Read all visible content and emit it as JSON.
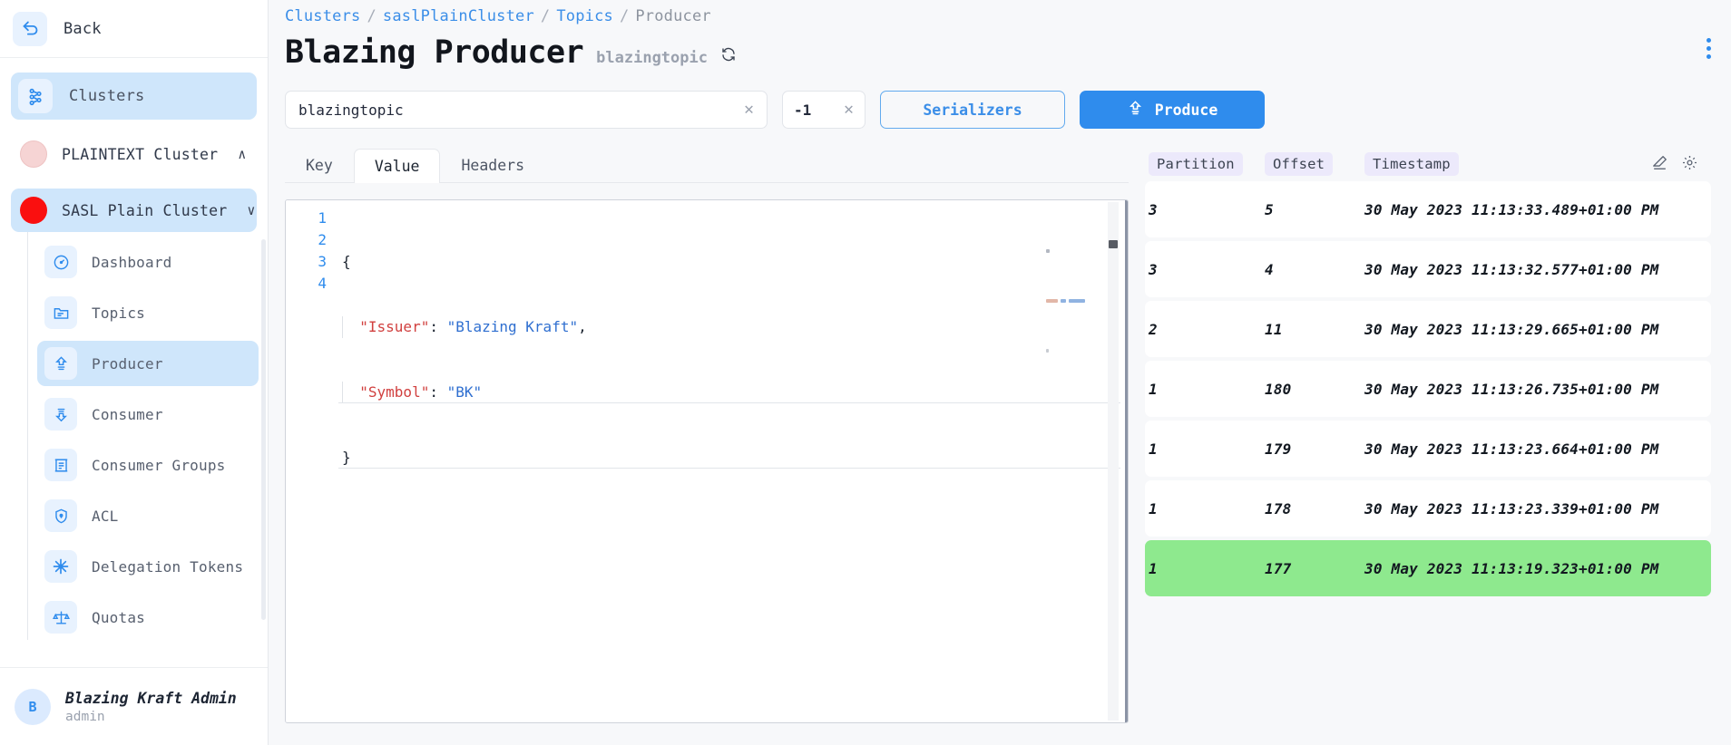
{
  "sidebar": {
    "back": {
      "label": "Back",
      "icon": "back-arrow-icon"
    },
    "clusters": {
      "label": "Clusters",
      "icon": "clusters-icon"
    },
    "cluster_list": [
      {
        "label": "PLAINTEXT Cluster",
        "dot_color": "#f6d4d4",
        "chevron": "∧",
        "active": false
      },
      {
        "label": "SASL Plain Cluster",
        "dot_color": "#fa0f0f",
        "chevron": "∨",
        "active": true
      }
    ],
    "items": [
      {
        "label": "Dashboard",
        "icon": "gauge-icon",
        "active": false
      },
      {
        "label": "Topics",
        "icon": "folder-icon",
        "active": false
      },
      {
        "label": "Producer",
        "icon": "upload-icon",
        "active": true
      },
      {
        "label": "Consumer",
        "icon": "download-icon",
        "active": false
      },
      {
        "label": "Consumer Groups",
        "icon": "list-box-icon",
        "active": false
      },
      {
        "label": "ACL",
        "icon": "shield-lock-icon",
        "active": false
      },
      {
        "label": "Delegation Tokens",
        "icon": "asterisk-icon",
        "active": false
      },
      {
        "label": "Quotas",
        "icon": "scales-icon",
        "active": false
      }
    ],
    "user": {
      "initial": "B",
      "name": "Blazing Kraft Admin",
      "role": "admin"
    }
  },
  "header": {
    "breadcrumb": [
      {
        "label": "Clusters",
        "link": true
      },
      {
        "label": "saslPlainCluster",
        "link": true
      },
      {
        "label": "Topics",
        "link": true
      },
      {
        "label": "Producer",
        "link": false
      }
    ],
    "separator": "/",
    "title": "Blazing Producer",
    "subtitle": "blazingtopic",
    "refresh_icon": "refresh-icon",
    "menu_icon": "kebab-menu-icon"
  },
  "toolbar": {
    "topic": {
      "value": "blazingtopic",
      "placeholder": "Topic",
      "clear_icon": "close-icon"
    },
    "partition": {
      "value": "-1",
      "placeholder": "Partition",
      "clear_icon": "close-icon"
    },
    "serializers_label": "Serializers",
    "produce_label": "Produce",
    "produce_icon": "upload-icon",
    "accent_color": "#2f8ced"
  },
  "editor": {
    "tabs": [
      {
        "label": "Key",
        "active": false
      },
      {
        "label": "Value",
        "active": true
      },
      {
        "label": "Headers",
        "active": false
      }
    ],
    "lines": [
      {
        "no": "1",
        "text": "{"
      },
      {
        "no": "2",
        "text": "  \"Issuer\": \"Blazing Kraft\","
      },
      {
        "no": "3",
        "text": "  \"Symbol\": \"BK\""
      },
      {
        "no": "4",
        "text": "}"
      }
    ],
    "json": {
      "Issuer": "Blazing Kraft",
      "Symbol": "BK"
    }
  },
  "records": {
    "columns": [
      "Partition",
      "Offset",
      "Timestamp"
    ],
    "actions": [
      {
        "icon": "eraser-icon"
      },
      {
        "icon": "gear-icon"
      }
    ],
    "selected_color": "#8ee98e",
    "rows": [
      {
        "partition": "3",
        "offset": "5",
        "timestamp": "30 May 2023 11:13:33.489+01:00 PM",
        "selected": false
      },
      {
        "partition": "3",
        "offset": "4",
        "timestamp": "30 May 2023 11:13:32.577+01:00 PM",
        "selected": false
      },
      {
        "partition": "2",
        "offset": "11",
        "timestamp": "30 May 2023 11:13:29.665+01:00 PM",
        "selected": false
      },
      {
        "partition": "1",
        "offset": "180",
        "timestamp": "30 May 2023 11:13:26.735+01:00 PM",
        "selected": false
      },
      {
        "partition": "1",
        "offset": "179",
        "timestamp": "30 May 2023 11:13:23.664+01:00 PM",
        "selected": false
      },
      {
        "partition": "1",
        "offset": "178",
        "timestamp": "30 May 2023 11:13:23.339+01:00 PM",
        "selected": false
      },
      {
        "partition": "1",
        "offset": "177",
        "timestamp": "30 May 2023 11:13:19.323+01:00 PM",
        "selected": true
      }
    ]
  }
}
